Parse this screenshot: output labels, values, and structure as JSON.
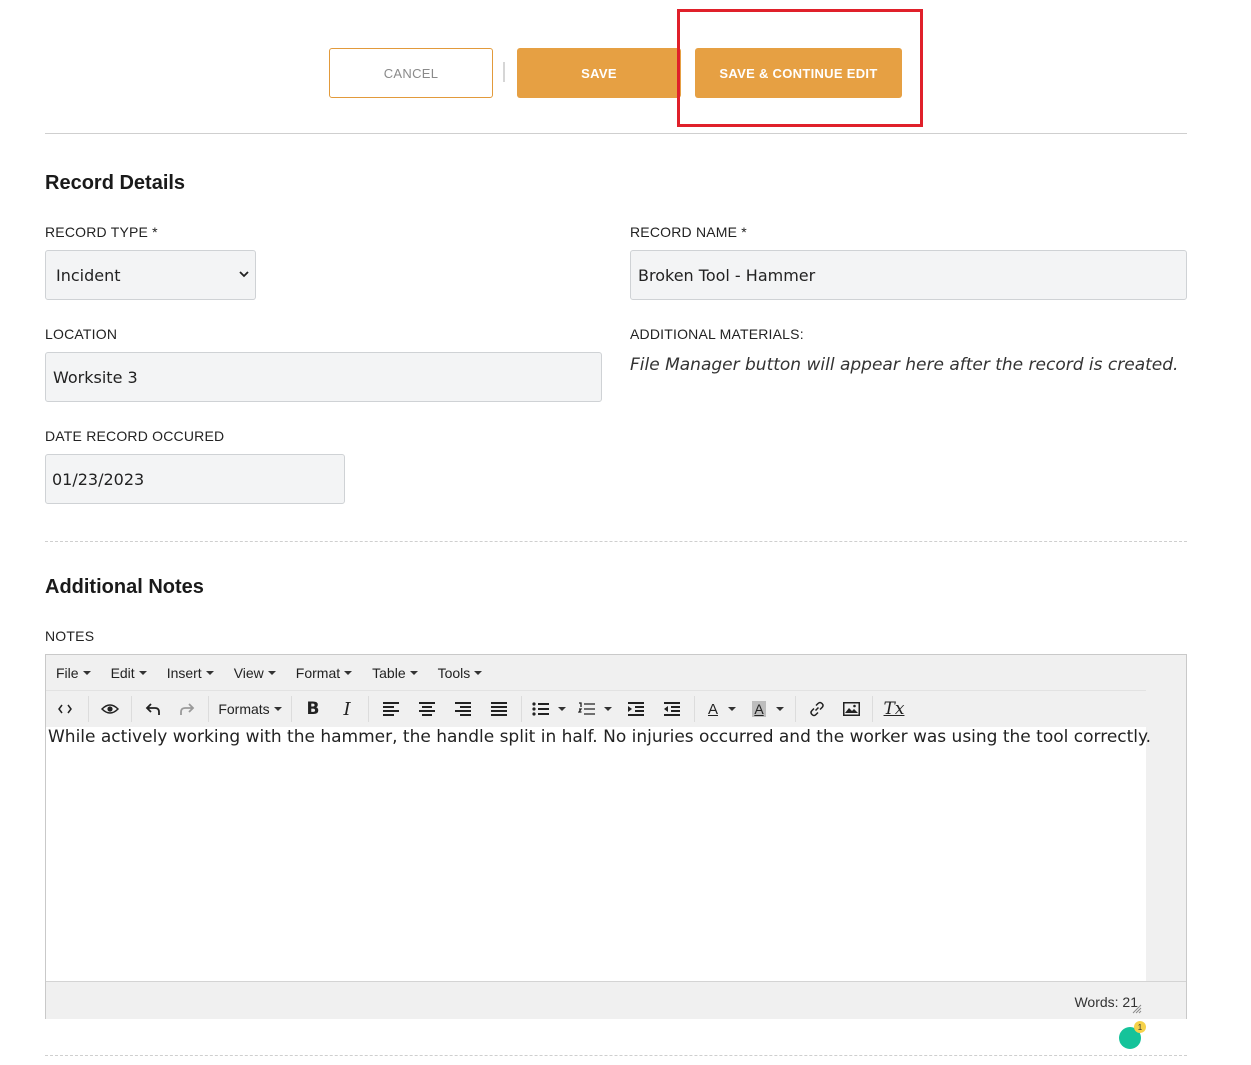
{
  "actions": {
    "cancel_label": "CANCEL",
    "save_label": "SAVE",
    "save_continue_label": "SAVE & CONTINUE EDIT"
  },
  "record_details": {
    "title": "Record Details",
    "record_type": {
      "label": "RECORD TYPE *",
      "value": "Incident"
    },
    "record_name": {
      "label": "RECORD NAME *",
      "value": "Broken Tool - Hammer"
    },
    "location": {
      "label": "LOCATION",
      "value": "Worksite 3"
    },
    "additional_materials": {
      "label": "ADDITIONAL MATERIALS:",
      "hint": "File Manager button will appear here after the record is created."
    },
    "date_occurred": {
      "label": "DATE RECORD OCCURED",
      "value": "01/23/2023"
    }
  },
  "additional_notes": {
    "title": "Additional Notes",
    "notes_label": "NOTES",
    "menubar": [
      "File",
      "Edit",
      "Insert",
      "View",
      "Format",
      "Table",
      "Tools"
    ],
    "toolbar": {
      "formats_label": "Formats",
      "bold": "B",
      "italic": "I",
      "clear_format": "Tx",
      "text_color": "A",
      "bg_color": "A"
    },
    "content": "While actively working with the hammer, the handle split in half. No injuries occurred and the worker was using the tool correctly.",
    "word_count": "Words: 21",
    "grammarly_count": "1"
  },
  "colors": {
    "accent": "#e6a043",
    "highlight": "#e0202a"
  }
}
